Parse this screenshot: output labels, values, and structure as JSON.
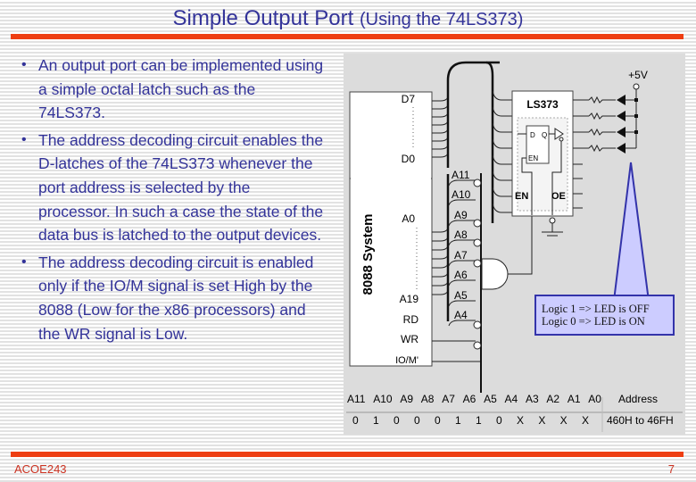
{
  "slide": {
    "title_main": "Simple Output Port",
    "title_sub": "(Using the 74LS373)",
    "bullets": [
      "An output port can be implemented using a simple octal latch such as the 74LS373.",
      "The address decoding circuit enables the D-latches of the 74LS373 whenever the port address is selected by the processor. In such a case the state of the data bus is latched to the output devices.",
      "The address decoding circuit is enabled only if the IO/M signal is set High by the 8088  (Low for the x86 processors) and the WR signal is Low."
    ],
    "footer_left": "ACOE243",
    "page_number": "7",
    "accent_color": "#ee3e12",
    "text_color": "#333399"
  },
  "diagram": {
    "system_label": "8088 System",
    "pins": [
      "D7",
      "D0",
      "A0",
      "A19",
      "RD",
      "WR",
      "IO/M'"
    ],
    "address_lines": [
      "A11",
      "A10",
      "A9",
      "A8",
      "A7",
      "A6",
      "A5",
      "A4"
    ],
    "chip_label": "LS373",
    "latch_labels": {
      "d": "D",
      "q": "Q",
      "en": "EN"
    },
    "chip_pins": {
      "en": "EN",
      "oe": "OE"
    },
    "supply_label": "+5V",
    "note_lines": [
      "Logic 1 => LED is OFF",
      "Logic 0 => LED is ON"
    ],
    "table": {
      "headers": [
        "A11",
        "A10",
        "A9",
        "A8",
        "A7",
        "A6",
        "A5",
        "A4",
        "A3",
        "A2",
        "A1",
        "A0"
      ],
      "values": [
        "0",
        "1",
        "0",
        "0",
        "0",
        "1",
        "1",
        "0",
        "X",
        "X",
        "X",
        "X"
      ],
      "address_header": "Address",
      "address_value": "460H to 46FH"
    }
  }
}
